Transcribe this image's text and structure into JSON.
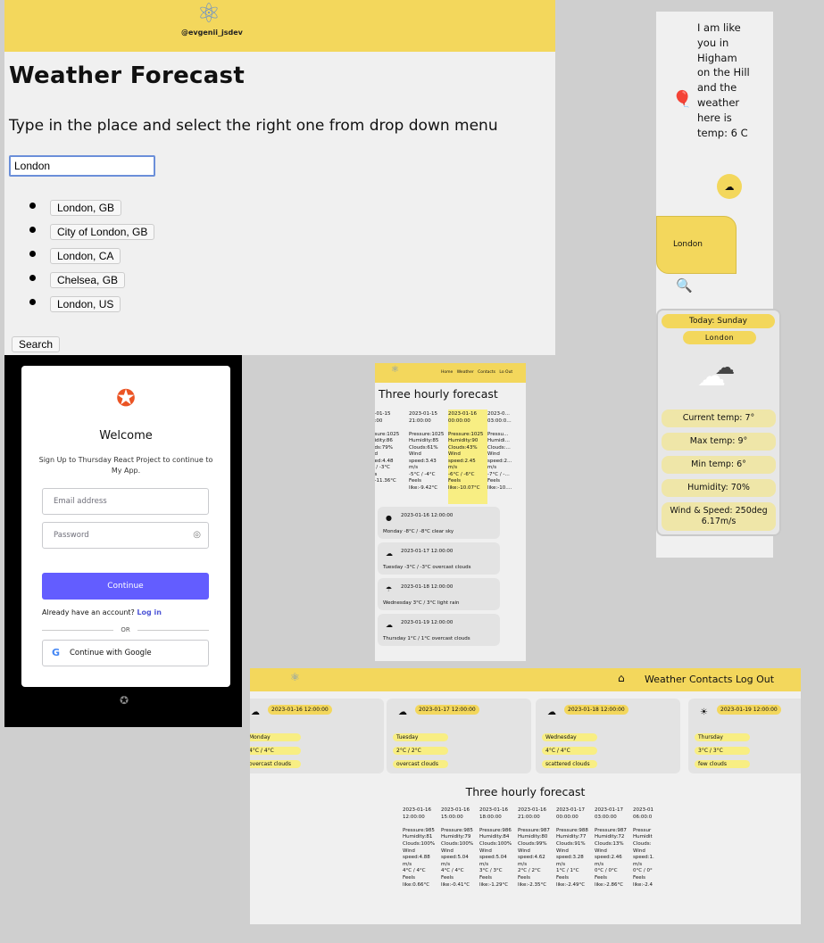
{
  "weather_page": {
    "logo_handle": "@evgenii_jsdev",
    "title": "Weather Forecast",
    "subtitle": "Type in the place and select the right one from drop down menu",
    "input_value": "London",
    "suggestions": [
      "London, GB",
      "City of London, GB",
      "London, CA",
      "Chelsea, GB",
      "London, US"
    ],
    "search_label": "Search"
  },
  "chat": {
    "bot_message": "I am like you in Higham on the Hill and the weather here is temp: 6 C",
    "user_message": "London",
    "today_label": "Today: Sunday",
    "location": "London",
    "rows": [
      "Current temp: 7°",
      "Max temp: 9°",
      "Min temp: 6°",
      "Humidity: 70%",
      "Wind & Speed: 250deg 6.17m/s"
    ]
  },
  "login": {
    "welcome": "Welcome",
    "description": "Sign Up to Thursday React Project to continue to My App.",
    "email_placeholder": "Email address",
    "password_placeholder": "Password",
    "continue_label": "Continue",
    "already_text": "Already have an account?",
    "login_link": "Log in",
    "or_label": "OR",
    "google_label": "Continue with Google"
  },
  "mobile_forecast": {
    "nav_links": [
      "Home",
      "Weather",
      "Contacts",
      "Lo Out"
    ],
    "title": "Three hourly forecast",
    "columns": [
      {
        "date": "…-01-15",
        "time": "…:00",
        "lines": [
          "…sure:1025",
          "…idity:86",
          "…ds:79%",
          "…d",
          "…ed:4.48",
          "",
          "… / -3°C",
          "…s",
          "…-11.36°C"
        ]
      },
      {
        "date": "2023-01-15",
        "time": "21:00:00",
        "lines": [
          "Pressure:1025",
          "Humidity:85",
          "Clouds:61%",
          "Wind",
          "speed:3.43",
          "m/s",
          "-5°C / -4°C",
          "Feels",
          "like:-9.42°C"
        ]
      },
      {
        "date": "2023-01-16",
        "time": "00:00:00",
        "lines": [
          "Pressure:1025",
          "Humidity:90",
          "Clouds:43%",
          "Wind",
          "speed:2.45",
          "m/s",
          "-6°C / -6°C",
          "Feels",
          "like:-10.07°C"
        ]
      },
      {
        "date": "2023-0…",
        "time": "03:00:0…",
        "lines": [
          "Pressu…",
          "Humidi…",
          "Clouds:…",
          "Wind",
          "speed:2…",
          "m/s",
          "-7°C / -…",
          "Feels",
          "like:-10.…"
        ]
      }
    ],
    "daily": [
      {
        "date": "2023-01-16 12:00:00",
        "desc": "Monday -8°C / -8°C clear sky"
      },
      {
        "date": "2023-01-17 12:00:00",
        "desc": "Tuesday -3°C / -3°C overcast clouds"
      },
      {
        "date": "2023-01-18 12:00:00",
        "desc": "Wednesday 3°C / 3°C light rain"
      },
      {
        "date": "2023-01-19 12:00:00",
        "desc": "Thursday 1°C / 1°C overcast clouds"
      }
    ]
  },
  "desktop_forecast": {
    "nav_links": [
      "Weather",
      "Contacts",
      "Log Out"
    ],
    "cards": [
      {
        "date": "2023-01-16 12:00:00",
        "day": "Monday",
        "temp": "4°C / 4°C",
        "desc": "overcast clouds"
      },
      {
        "date": "2023-01-17 12:00:00",
        "day": "Tuesday",
        "temp": "2°C / 2°C",
        "desc": "overcast clouds"
      },
      {
        "date": "2023-01-18 12:00:00",
        "day": "Wednesday",
        "temp": "4°C / 4°C",
        "desc": "scattered clouds"
      },
      {
        "date": "2023-01-19 12:00:00",
        "day": "Thursday",
        "temp": "3°C / 3°C",
        "desc": "few clouds"
      }
    ],
    "title": "Three hourly forecast",
    "columns": [
      {
        "date": "2023-01-16",
        "time": "12:00:00",
        "lines": [
          "Pressure:985",
          "Humidity:81",
          "Clouds:100%",
          "Wind",
          "speed:4.88",
          "m/s",
          "4°C / 4°C",
          "Feels",
          "like:0.66°C"
        ]
      },
      {
        "date": "2023-01-16",
        "time": "15:00:00",
        "lines": [
          "Pressure:985",
          "Humidity:79",
          "Clouds:100%",
          "Wind",
          "speed:5.04",
          "m/s",
          "4°C / 4°C",
          "Feels",
          "like:-0.41°C"
        ]
      },
      {
        "date": "2023-01-16",
        "time": "18:00:00",
        "lines": [
          "Pressure:986",
          "Humidity:84",
          "Clouds:100%",
          "Wind",
          "speed:5.04",
          "m/s",
          "3°C / 3°C",
          "Feels",
          "like:-1.29°C"
        ]
      },
      {
        "date": "2023-01-16",
        "time": "21:00:00",
        "lines": [
          "Pressure:987",
          "Humidity:80",
          "Clouds:99%",
          "Wind",
          "speed:4.62",
          "m/s",
          "2°C / 2°C",
          "Feels",
          "like:-2.35°C"
        ]
      },
      {
        "date": "2023-01-17",
        "time": "00:00:00",
        "lines": [
          "Pressure:988",
          "Humidity:77",
          "Clouds:91%",
          "Wind",
          "speed:3.28",
          "m/s",
          "1°C / 1°C",
          "Feels",
          "like:-2.49°C"
        ]
      },
      {
        "date": "2023-01-17",
        "time": "03:00:00",
        "lines": [
          "Pressure:987",
          "Humidity:72",
          "Clouds:13%",
          "Wind",
          "speed:2.46",
          "m/s",
          "0°C / 0°C",
          "Feels",
          "like:-2.86°C"
        ]
      },
      {
        "date": "2023-01",
        "time": "06:00:0",
        "lines": [
          "Pressur",
          "Humidit",
          "Clouds:",
          "Wind",
          "speed:1.",
          "m/s",
          "0°C / 0°",
          "Feels",
          "like:-2.4"
        ]
      }
    ]
  }
}
